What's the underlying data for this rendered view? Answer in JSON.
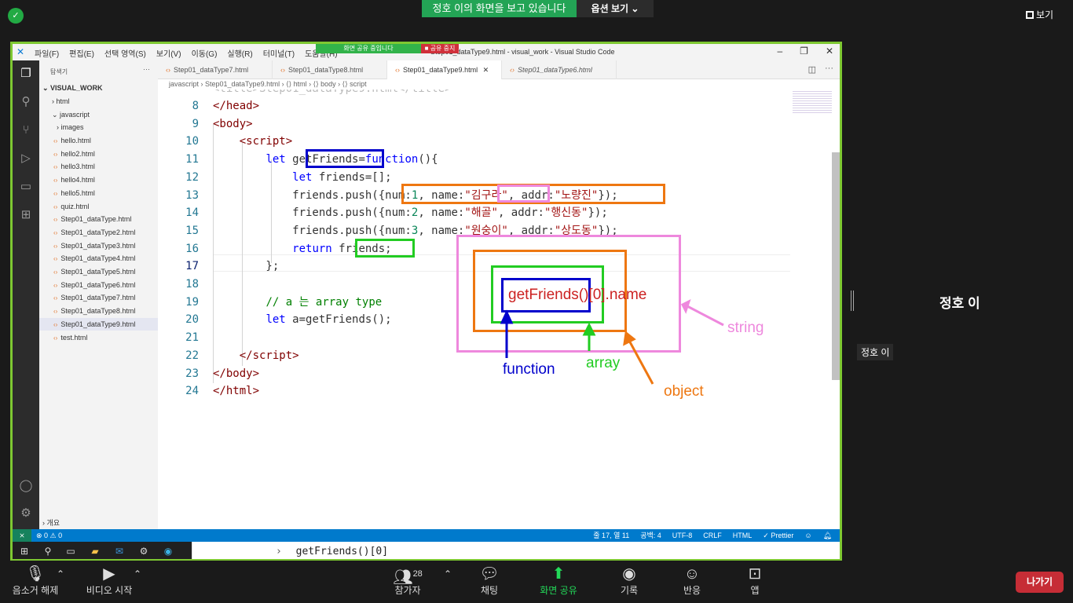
{
  "zoom": {
    "banner": "정호 이의 화면을 보고 있습니다",
    "view_options": "옵션 보기 ⌄",
    "view_button": "보기",
    "participant_name": "정호 이",
    "name_tag": "정호 이",
    "bottom": {
      "mute": "음소거 해제",
      "video": "비디오 시작",
      "participants": "참가자",
      "participant_count": "28",
      "chat": "채팅",
      "share": "화면 공유",
      "record": "기록",
      "reactions": "반응",
      "apps": "앱",
      "leave": "나가기"
    }
  },
  "vscode": {
    "menu": [
      "파일(F)",
      "편집(E)",
      "선택 영역(S)",
      "보기(V)",
      "이동(G)",
      "실행(R)",
      "터미널(T)",
      "도움말(H)"
    ],
    "share_pill": "화면 공유 중입니다",
    "stop_share": "■ 공유 중지",
    "window_title": "Step01_dataType9.html - visual_work - Visual Studio Code",
    "explorer_header": "탐색기",
    "workspace": "VISUAL_WORK",
    "folders": [
      "html",
      "javascript",
      "images"
    ],
    "files": [
      "hello.html",
      "hello2.html",
      "hello3.html",
      "hello4.html",
      "hello5.html",
      "quiz.html",
      "Step01_dataType.html",
      "Step01_dataType2.html",
      "Step01_dataType3.html",
      "Step01_dataType4.html",
      "Step01_dataType5.html",
      "Step01_dataType6.html",
      "Step01_dataType7.html",
      "Step01_dataType8.html",
      "Step01_dataType9.html",
      "test.html"
    ],
    "outline": "개요",
    "tabs": [
      "Step01_dataType7.html",
      "Step01_dataType8.html",
      "Step01_dataType9.html",
      "Step01_dataType6.html"
    ],
    "breadcrumb": "javascript  ›  Step01_dataType9.html  ›  ⟨⟩ html  ›  ⟨⟩ body  ›  ⟨⟩ script",
    "line_numbers": [
      "8",
      "9",
      "10",
      "11",
      "12",
      "13",
      "14",
      "15",
      "16",
      "17",
      "18",
      "19",
      "20",
      "21",
      "22",
      "23",
      "24"
    ],
    "status_left": "⊗ 0 ⚠ 0",
    "status_right": [
      "줄 17, 열 11",
      "공백: 4",
      "UTF-8",
      "CRLF",
      "HTML",
      "✓ Prettier"
    ],
    "console_input": "getFriends()[0]"
  },
  "annotations": {
    "expression": "getFriends()[0].name",
    "labels": {
      "function": "function",
      "array": "array",
      "object": "object",
      "string": "string"
    },
    "colors": {
      "function": "#0000cc",
      "array": "#22cc22",
      "object": "#ee7711",
      "string": "#ee88dd",
      "expression": "#cc2222"
    }
  }
}
